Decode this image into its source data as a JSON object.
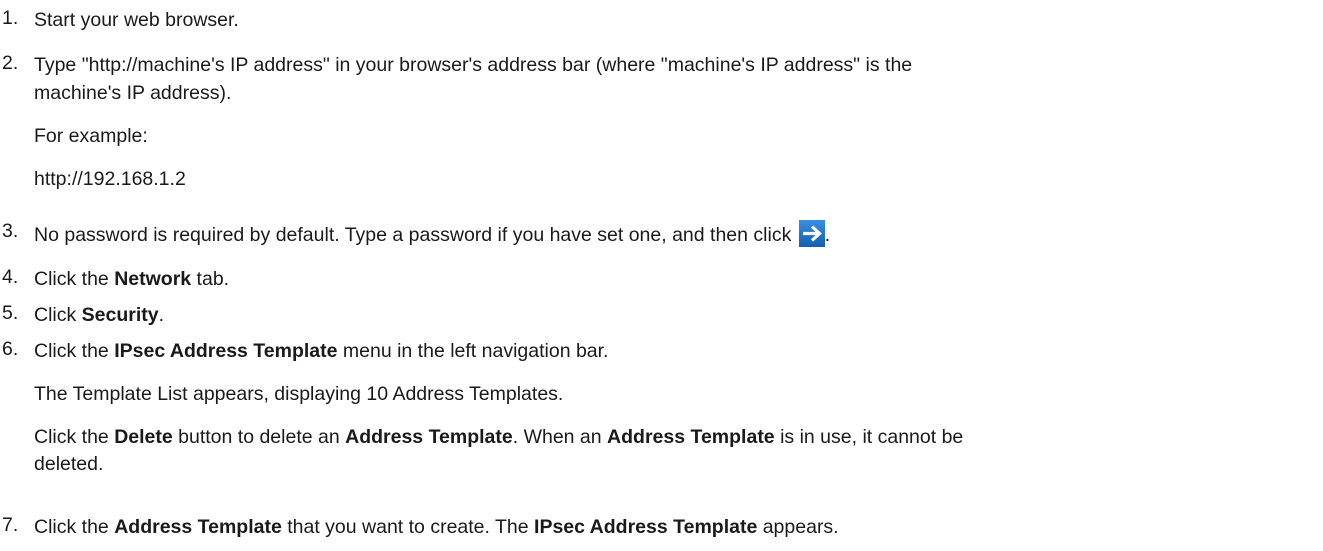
{
  "steps": [
    {
      "num": "1.",
      "text": "Start your web browser."
    },
    {
      "num": "2.",
      "line1": "Type \"http://machine's IP address\" in your browser's address bar (where \"machine's IP address\" is the",
      "line2": "machine's IP address).",
      "example_label": "For example:",
      "example_url": "http://192.168.1.2"
    },
    {
      "num": "3.",
      "text": "No password is required by default. Type a password if you have set one, and then click",
      "after_icon": ".",
      "icon": "arrow-right-icon"
    },
    {
      "num": "4.",
      "pre": "Click the ",
      "bold": "Network",
      "post": " tab."
    },
    {
      "num": "5.",
      "pre": "Click ",
      "bold": "Security",
      "post": "."
    },
    {
      "num": "6.",
      "pre": "Click the ",
      "bold": "IPsec Address Template",
      "post": " menu in the left navigation bar.",
      "note1": "The Template List appears, displaying 10 Address Templates.",
      "note2_pre": "Click the ",
      "note2_bold1": "Delete",
      "note2_mid1": " button to delete an ",
      "note2_bold2": "Address Template",
      "note2_mid2": ". When an ",
      "note2_bold3": "Address Template",
      "note2_post": " is in use, it cannot be",
      "note2_line2": "deleted."
    },
    {
      "num": "7.",
      "pre": "Click the ",
      "bold1": "Address Template",
      "mid": " that you want to create. The ",
      "bold2": "IPsec Address Template",
      "post": " appears."
    }
  ],
  "colors": {
    "icon_bg": "#1b6fc2",
    "icon_arrow": "#ffffff",
    "text": "#1a1a1a"
  }
}
